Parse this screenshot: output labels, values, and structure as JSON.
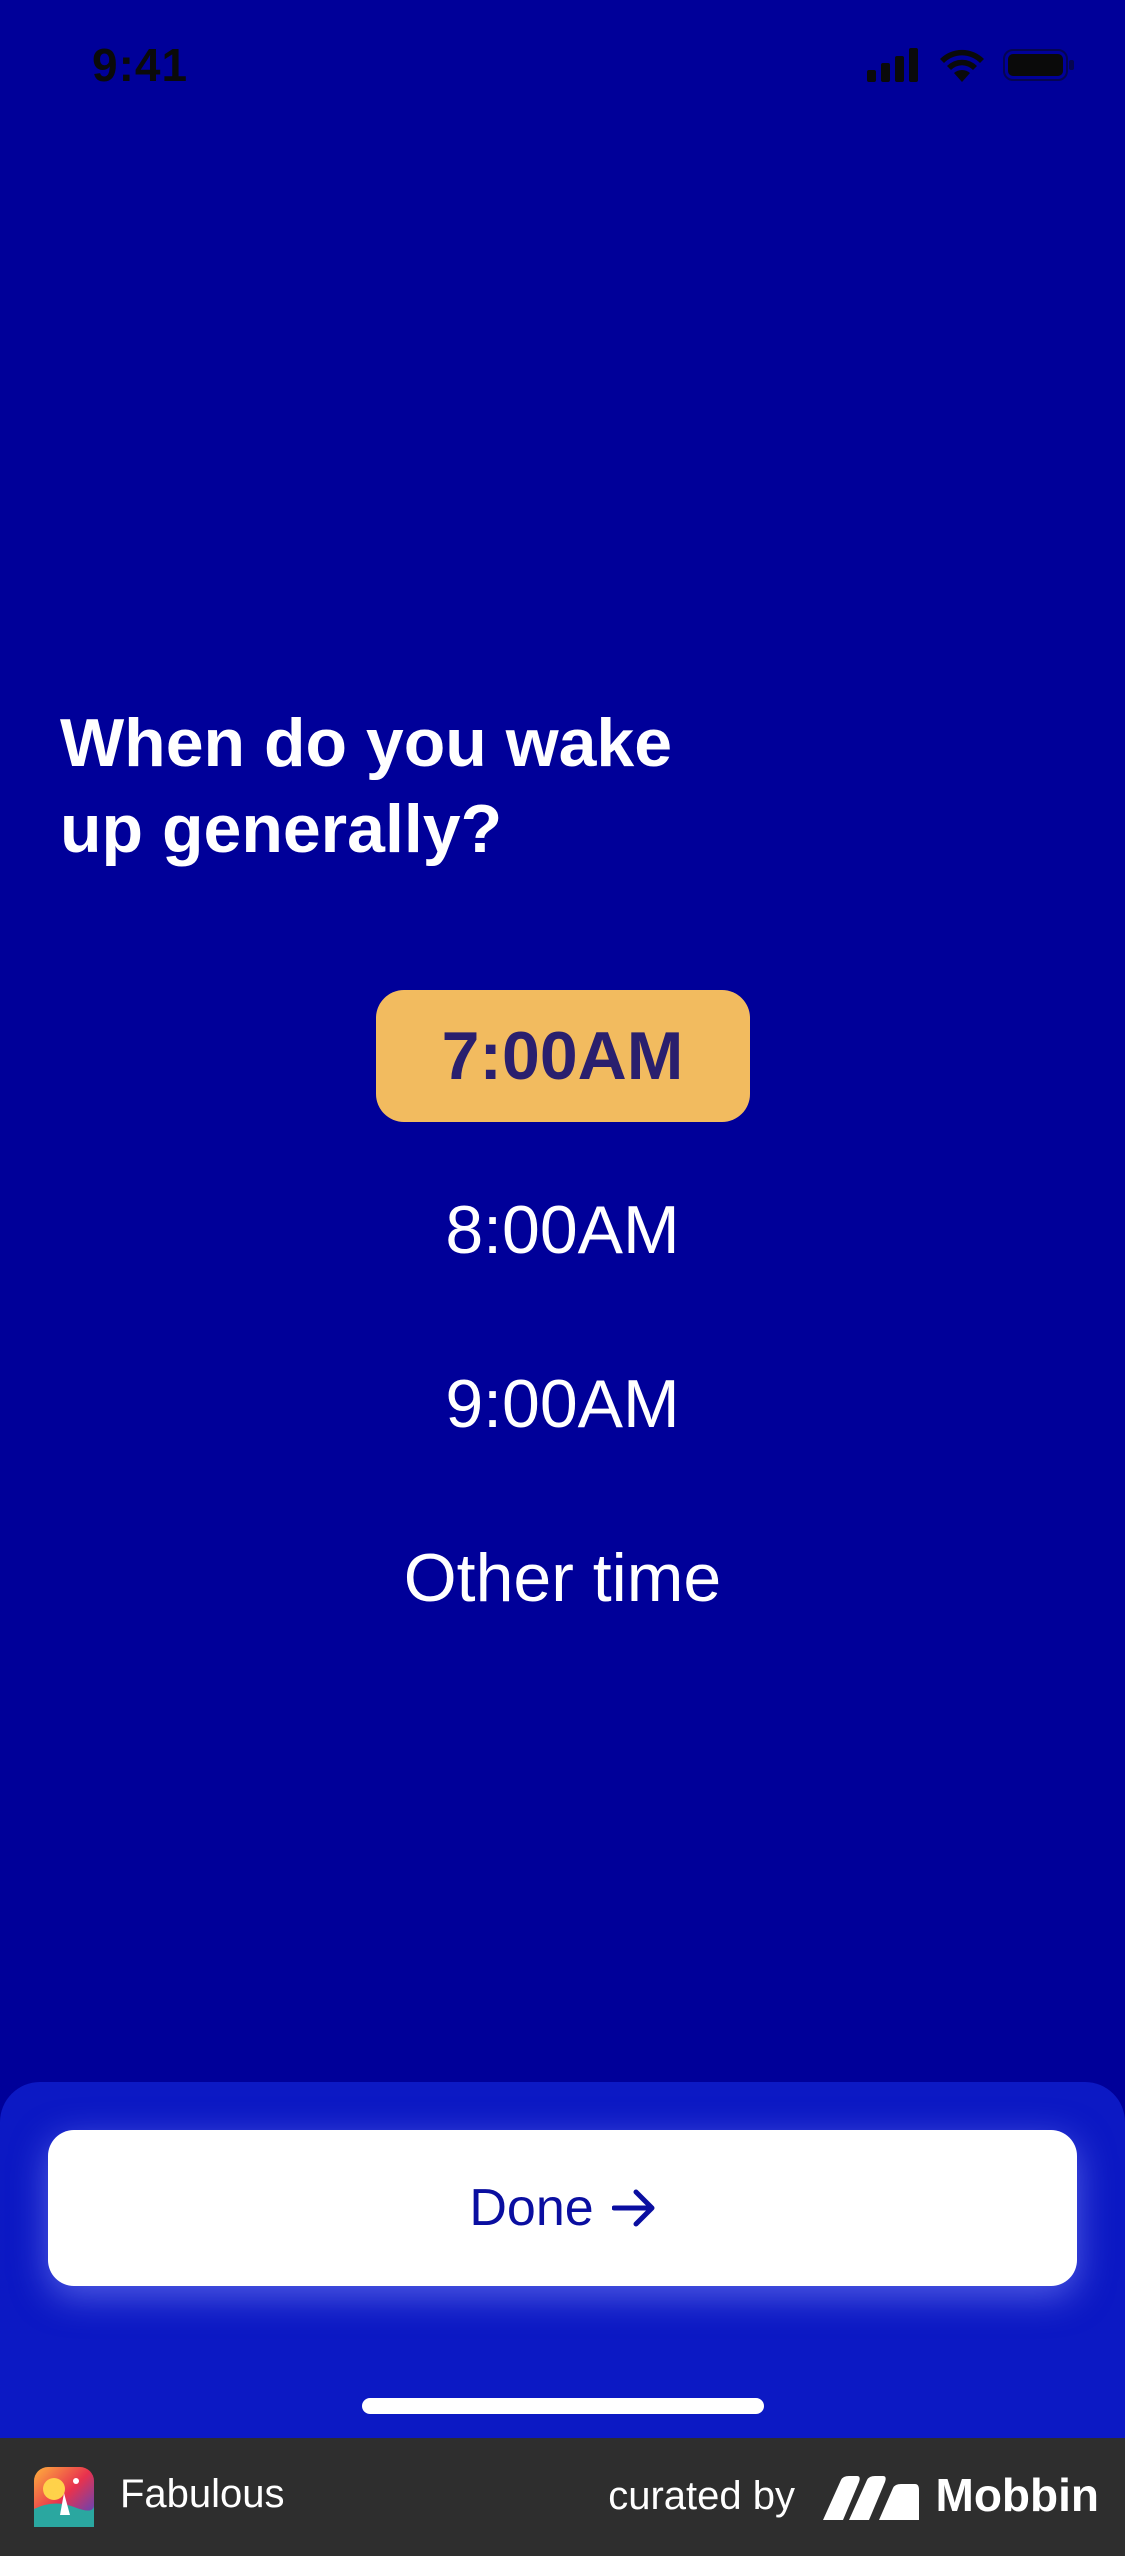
{
  "status_bar": {
    "time": "9:41",
    "icons": [
      "cellular-signal-icon",
      "wifi-icon",
      "battery-icon"
    ]
  },
  "question": "When do you wake up generally?",
  "options": [
    {
      "label": "7:00AM",
      "selected": true
    },
    {
      "label": "8:00AM",
      "selected": false
    },
    {
      "label": "9:00AM",
      "selected": false
    },
    {
      "label": "Other time",
      "selected": false
    }
  ],
  "done_button": {
    "label": "Done",
    "icon": "arrow-right-icon"
  },
  "footer": {
    "app_name": "Fabulous",
    "curated_label": "curated by",
    "brand_name": "Mobbin"
  },
  "colors": {
    "background": "#000099",
    "sheet": "#0c19c4",
    "selected_option": "#f2bb5f",
    "selected_text": "#2a1f6e",
    "button_text": "#0a0ea0",
    "footer": "#2e2e2e"
  }
}
